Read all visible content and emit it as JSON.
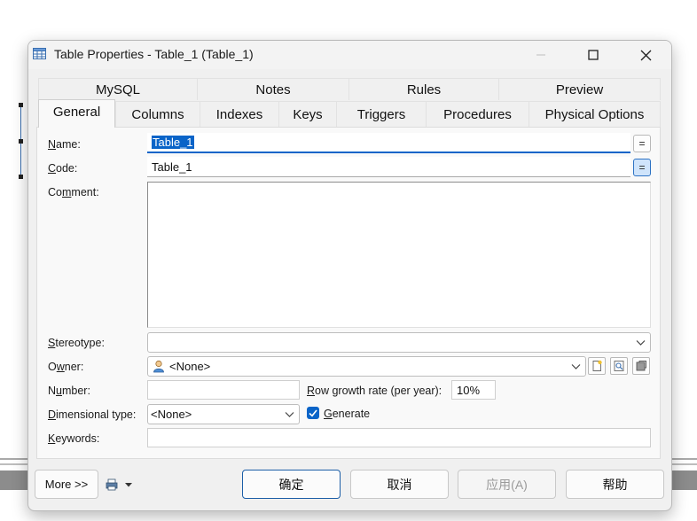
{
  "window": {
    "title": "Table Properties - Table_1 (Table_1)"
  },
  "tabs_row1": [
    "MySQL",
    "Notes",
    "Rules",
    "Preview"
  ],
  "tabs_row2": [
    "General",
    "Columns",
    "Indexes",
    "Keys",
    "Triggers",
    "Procedures",
    "Physical Options"
  ],
  "form": {
    "name_label_u": "N",
    "name_label_rest": "ame:",
    "name_value": "Table_1",
    "code_label_u": "C",
    "code_label_rest": "ode:",
    "code_value": "Table_1",
    "comment_label_pre": "Co",
    "comment_label_u": "m",
    "comment_label_rest": "ment:",
    "stereotype_label_u": "S",
    "stereotype_label_rest": "tereotype:",
    "stereotype_value": "",
    "owner_label_pre": "O",
    "owner_label_u": "w",
    "owner_label_rest": "ner:",
    "owner_value": "<None>",
    "number_label_pre": "N",
    "number_label_u": "u",
    "number_label_rest": "mber:",
    "number_value": "",
    "row_growth_label_u": "R",
    "row_growth_label_rest": "ow growth rate (per year):",
    "row_growth_value": "10%",
    "dimensional_label_u": "D",
    "dimensional_label_rest": "imensional type:",
    "dimensional_value": "<None>",
    "generate_label_u": "G",
    "generate_label_rest": "enerate",
    "generate_checked": true,
    "keywords_label_u": "K",
    "keywords_label_rest": "eywords:",
    "keywords_value": "",
    "equals_glyph": "="
  },
  "footer": {
    "more_label": "More >>",
    "ok_label": "确定",
    "cancel_label": "取消",
    "apply_label": "应用(A)",
    "help_label": "帮助"
  },
  "colors": {
    "accent": "#0a64c8",
    "selection": "#0a64c8"
  }
}
